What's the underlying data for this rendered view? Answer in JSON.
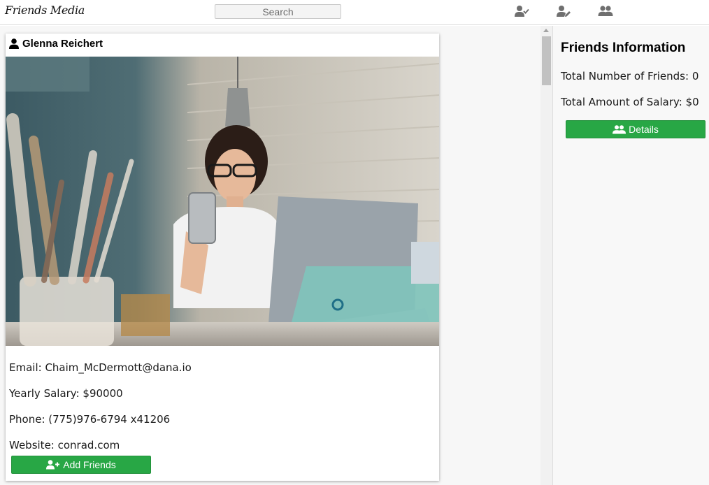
{
  "app": {
    "brand": "Friends Media"
  },
  "search": {
    "placeholder": "Search"
  },
  "nav": {
    "icons": [
      "user-check-icon",
      "user-edit-icon",
      "users-icon"
    ]
  },
  "card": {
    "name": "Glenna Reichert",
    "email_line": "Email: Chaim_McDermott@dana.io",
    "salary_line": "Yearly Salary: $90000",
    "phone_line": "Phone: (775)976-6794 x41206",
    "website_line": "Website: conrad.com",
    "add_button_label": "Add Friends"
  },
  "panel": {
    "title": "Friends Information",
    "total_friends_line": "Total Number of Friends: 0",
    "total_salary_line": "Total Amount of Salary: $0",
    "details_button_label": "Details"
  },
  "colors": {
    "accent_green": "#28a745",
    "panel_bg": "#f8f8f8"
  }
}
